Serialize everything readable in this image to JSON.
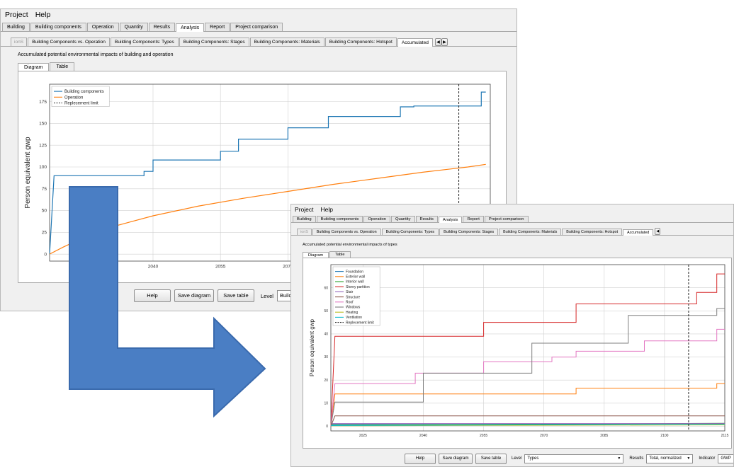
{
  "menu": [
    "Project",
    "Help"
  ],
  "main_tabs": [
    "Building",
    "Building components",
    "Operation",
    "Quantity",
    "Results",
    "Analysis",
    "Report",
    "Project comparison"
  ],
  "active_main_tab": "Analysis",
  "analysis_tabs_back": [
    "ionS",
    "Building Components vs. Operation",
    "Building Components: Types",
    "Building Components: Stages",
    "Building Components: Materials",
    "Building Components: Hotspot",
    "Accumulated"
  ],
  "analysis_tabs_front": [
    "ionS",
    "Building Components vs. Operation",
    "Building Components: Types",
    "Building Components: Stages",
    "Building Components: Materials",
    "Building Components: Hotspot",
    "Accumulated"
  ],
  "back_window": {
    "section_title": "Accumulated potential environmental impacts of building and operation",
    "view_tabs": [
      "Diagram",
      "Table"
    ],
    "buttons": {
      "help": "Help",
      "save_diagram": "Save diagram",
      "save_table": "Save table"
    },
    "level_label": "Level",
    "level_value": "Builde"
  },
  "front_window": {
    "section_title": "Accumulated potential environmental impacts of types",
    "view_tabs": [
      "Diagram",
      "Table"
    ],
    "buttons": {
      "help": "Help",
      "save_diagram": "Save diagram",
      "save_table": "Save table"
    },
    "level_label": "Level",
    "level_value": "Types",
    "results_label": "Results",
    "results_value": "Total, normalized",
    "indicator_label": "Indicator",
    "indicator_value": "GWP"
  },
  "arrow_color": "#4a7ec4",
  "chart_data": [
    {
      "type": "line",
      "title": "",
      "ylabel": "Person equivalent gwp",
      "xlabel": "",
      "xlim": [
        2017,
        2115
      ],
      "ylim": [
        -8,
        195
      ],
      "x_ticks": [
        2040,
        2055,
        2070
      ],
      "y_ticks": [
        0,
        25,
        50,
        75,
        100,
        125,
        150,
        175
      ],
      "grid": true,
      "legend_position": "top-left",
      "replacement_limit": 2108,
      "series": [
        {
          "name": "Building components",
          "color": "#1f77b4",
          "style": "step",
          "x": [
            2017,
            2018,
            2038,
            2038,
            2040,
            2040,
            2055,
            2055,
            2059,
            2059,
            2070,
            2070,
            2079,
            2079,
            2095,
            2095,
            2098,
            2098,
            2113,
            2113,
            2114
          ],
          "y": [
            0,
            90,
            90,
            95,
            95,
            108,
            108,
            118,
            118,
            132,
            132,
            145,
            145,
            158,
            158,
            169,
            169,
            170,
            170,
            186,
            186
          ]
        },
        {
          "name": "Operation",
          "color": "#ff7f0e",
          "style": "line",
          "x": [
            2017,
            2020,
            2025,
            2030,
            2035,
            2040,
            2050,
            2060,
            2070,
            2080,
            2090,
            2100,
            2110,
            2114
          ],
          "y": [
            0,
            8,
            20,
            30,
            37,
            44,
            55,
            64,
            72,
            80,
            87,
            94,
            100,
            103
          ]
        },
        {
          "name": "Replecement limit",
          "color": "#222222",
          "style": "dashed"
        }
      ]
    },
    {
      "type": "line",
      "title": "",
      "ylabel": "Person equivalent gwp",
      "xlabel": "",
      "xlim": [
        2017,
        2115
      ],
      "ylim": [
        -2,
        70
      ],
      "x_ticks": [
        2025,
        2040,
        2055,
        2070,
        2085,
        2100,
        2115
      ],
      "y_ticks": [
        0,
        10,
        20,
        30,
        40,
        50,
        60
      ],
      "grid": true,
      "legend_position": "top-left",
      "replacement_limit": 2106,
      "series": [
        {
          "name": "Foundation",
          "color": "#1f77b4",
          "x": [
            2017,
            2115
          ],
          "y": [
            0.8,
            0.8
          ]
        },
        {
          "name": "Exterior wall",
          "color": "#ff7f0e",
          "x": [
            2017,
            2018,
            2078,
            2078,
            2113,
            2113,
            2115
          ],
          "y": [
            0,
            14,
            14,
            16.5,
            16.5,
            18.5,
            18.5
          ]
        },
        {
          "name": "Interior wall",
          "color": "#2ca02c",
          "x": [
            2017,
            2115
          ],
          "y": [
            0.5,
            1.3
          ]
        },
        {
          "name": "Storey partition",
          "color": "#d62728",
          "x": [
            2017,
            2018,
            2055,
            2055,
            2078,
            2078,
            2108,
            2108,
            2113,
            2113,
            2115
          ],
          "y": [
            0,
            39,
            39,
            45,
            45,
            53,
            53,
            58,
            58,
            66,
            66
          ]
        },
        {
          "name": "Stair",
          "color": "#9467bd",
          "x": [
            2017,
            2115
          ],
          "y": [
            1.2,
            1.2
          ]
        },
        {
          "name": "Structure",
          "color": "#8c564b",
          "x": [
            2017,
            2018,
            2115
          ],
          "y": [
            0,
            4.5,
            4.5
          ]
        },
        {
          "name": "Roof",
          "color": "#e377c2",
          "x": [
            2017,
            2018,
            2038,
            2038,
            2055,
            2055,
            2072,
            2072,
            2078,
            2078,
            2095,
            2095,
            2113,
            2113,
            2115
          ],
          "y": [
            0,
            18.5,
            18.5,
            23,
            23,
            28,
            28,
            30,
            30,
            32.5,
            32.5,
            37,
            37,
            42,
            42
          ]
        },
        {
          "name": "Windows",
          "color": "#7f7f7f",
          "x": [
            2017,
            2018,
            2040,
            2040,
            2067,
            2067,
            2091,
            2091,
            2113,
            2113,
            2115
          ],
          "y": [
            0,
            10.5,
            10.5,
            23,
            23,
            36,
            36,
            48,
            48,
            51,
            51
          ]
        },
        {
          "name": "Heating",
          "color": "#bcbd22",
          "x": [
            2017,
            2115
          ],
          "y": [
            0.2,
            0.6
          ]
        },
        {
          "name": "Ventilation",
          "color": "#17becf",
          "x": [
            2017,
            2115
          ],
          "y": [
            0.3,
            0.9
          ]
        },
        {
          "name": "Replecement limit",
          "color": "#222222",
          "style": "dashed"
        }
      ]
    }
  ]
}
